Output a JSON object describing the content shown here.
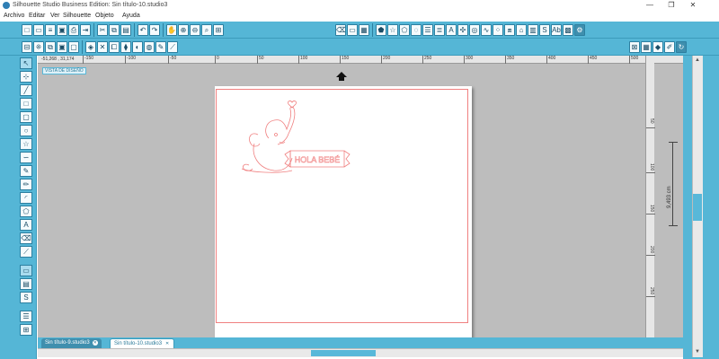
{
  "window": {
    "title": "Silhouette Studio Business Edition: Sin título-10.studio3",
    "controls": [
      "—",
      "❐",
      "✕"
    ]
  },
  "menu": [
    "Archivo",
    "Editar",
    "Ver",
    "Silhouette",
    "Objeto",
    "Ayuda"
  ],
  "canvas": {
    "coords": "-51,268 , 31,174",
    "view_label": "VISTA DE DISEÑO",
    "ruler_h_labels": [
      "-150",
      "-100",
      "-50",
      "0",
      "50",
      "100",
      "150",
      "200",
      "250",
      "300",
      "350",
      "400",
      "450",
      "500"
    ],
    "ruler_v_labels": [
      "50",
      "100",
      "150",
      "200",
      "250"
    ],
    "dimension_label": "9,493 cm",
    "design_text": "HOLA BEBÉ",
    "colors": {
      "cut_line": "#f08080",
      "accent": "#55b6d6"
    }
  },
  "tabs": [
    {
      "label": "Sin título-9.studio3",
      "active": false
    },
    {
      "label": "Sin título-10.studio3",
      "active": true
    }
  ],
  "toolbar_icons": {
    "row1": [
      "new-document-icon",
      "open-icon",
      "library-icon",
      "save-icon",
      "print-icon",
      "send-icon",
      "cut-icon",
      "copy-icon",
      "paste-icon",
      "undo-icon",
      "redo-icon",
      "pan-icon",
      "zoom-in-icon",
      "zoom-out-icon",
      "zoom-select-icon",
      "fit-page-icon"
    ],
    "row1_right": [
      "eraser-icon",
      "page-setup-icon",
      "grid-icon",
      "shape-icon",
      "star-icon",
      "polygon-icon",
      "knife-icon",
      "lines-icon",
      "stroke-icon",
      "text-style-icon",
      "trace-icon",
      "offset-icon",
      "sketch-icon",
      "rhinestone-icon",
      "pixscan-icon",
      "library-store-icon",
      "send-panel-icon",
      "design-store-icon",
      "ab-icon",
      "fill-icon",
      "settings-icon"
    ]
  },
  "left_tools": [
    "select-icon",
    "point-edit-icon",
    "line-icon",
    "rectangle-icon",
    "rounded-rect-icon",
    "ellipse-icon",
    "polygon-tool-icon",
    "curve-icon",
    "freehand-icon",
    "smooth-freehand-icon",
    "arc-icon",
    "regular-polygon-icon",
    "text-icon",
    "eraser-tool-icon",
    "knife-tool-icon",
    "design-view-icon",
    "library-view-icon",
    "store-view-icon"
  ]
}
